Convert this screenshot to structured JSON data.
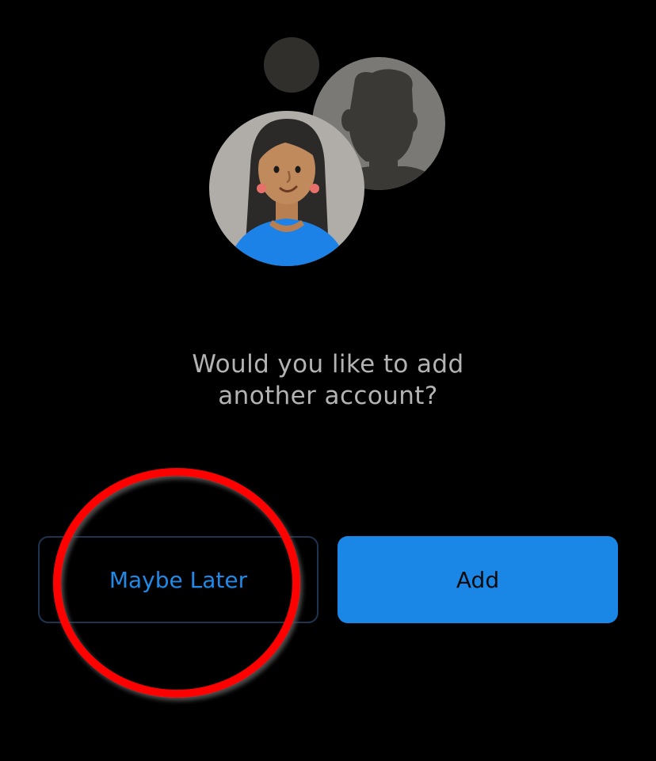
{
  "prompt": {
    "line1": "Would you like to add",
    "line2": "another account?"
  },
  "buttons": {
    "maybe_later_label": "Maybe Later",
    "add_label": "Add"
  },
  "colors": {
    "background": "#000000",
    "prompt_text": "#b3b3b3",
    "accent": "#1a87e6",
    "later_text": "#1f8ae8",
    "add_text": "#0b0b0b",
    "later_border": "#1d3350",
    "annotation": "#ff0000"
  }
}
